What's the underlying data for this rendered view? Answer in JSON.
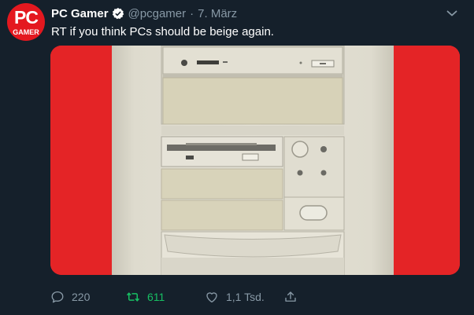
{
  "tweet": {
    "author_name": "PC Gamer",
    "handle": "@pcgamer",
    "separator": "·",
    "date": "7. März",
    "text": "RT if you think PCs should be beige again.",
    "verified": true,
    "avatar": {
      "logo_text": "PC",
      "logo_subtext": "GAMER",
      "color": "#e4181f"
    },
    "media": {
      "description_icon": "beige-pc-tower-image",
      "background_color": "#e42426",
      "case_color": "#dcd9cc"
    },
    "actions": {
      "reply_count": "220",
      "retweet_count": "611",
      "like_count": "1,1 Tsd.",
      "retweeted": true
    }
  },
  "theme": {
    "background": "#15202b",
    "secondary_text": "#8899a6",
    "retweet_green": "#17bf63",
    "verified_blue": "#1da1f2"
  }
}
